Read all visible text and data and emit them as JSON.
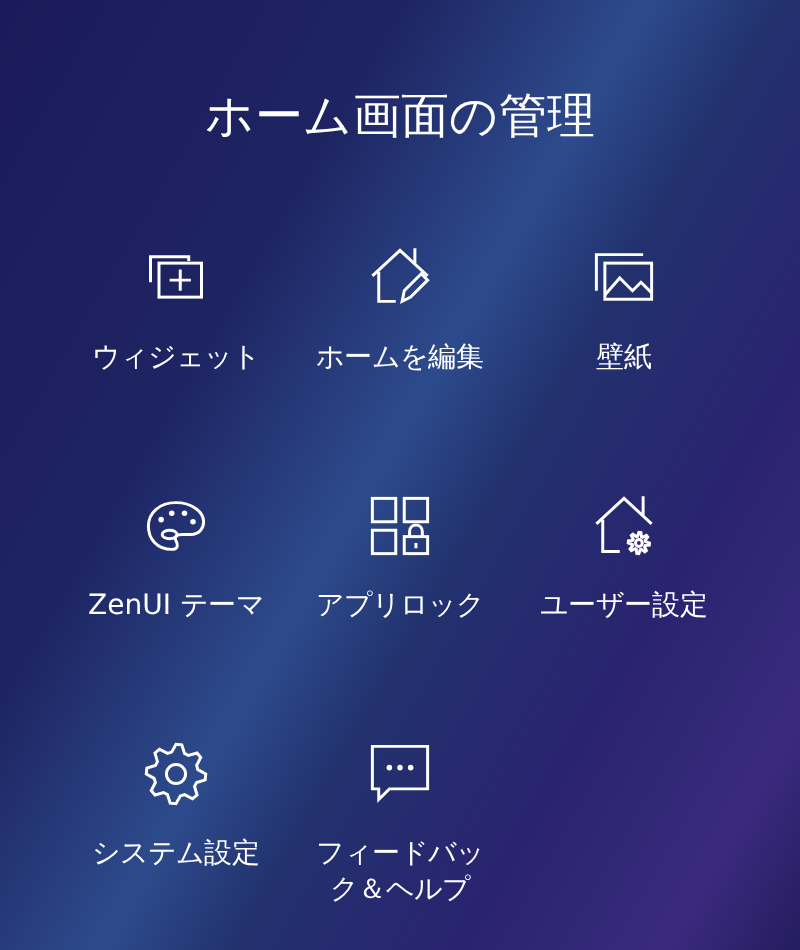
{
  "title": "ホーム画面の管理",
  "items": [
    {
      "kind": "widget",
      "label": "ウィジェット"
    },
    {
      "kind": "home-edit",
      "label": "ホームを編集"
    },
    {
      "kind": "wallpaper",
      "label": "壁紙"
    },
    {
      "kind": "palette",
      "label": "ZenUI テーマ"
    },
    {
      "kind": "lock-grid",
      "label": "アプリロック"
    },
    {
      "kind": "home-gear",
      "label": "ユーザー設定"
    },
    {
      "kind": "gear",
      "label": "システム設定"
    },
    {
      "kind": "chat",
      "label": "フィードバック＆ヘルプ"
    }
  ]
}
